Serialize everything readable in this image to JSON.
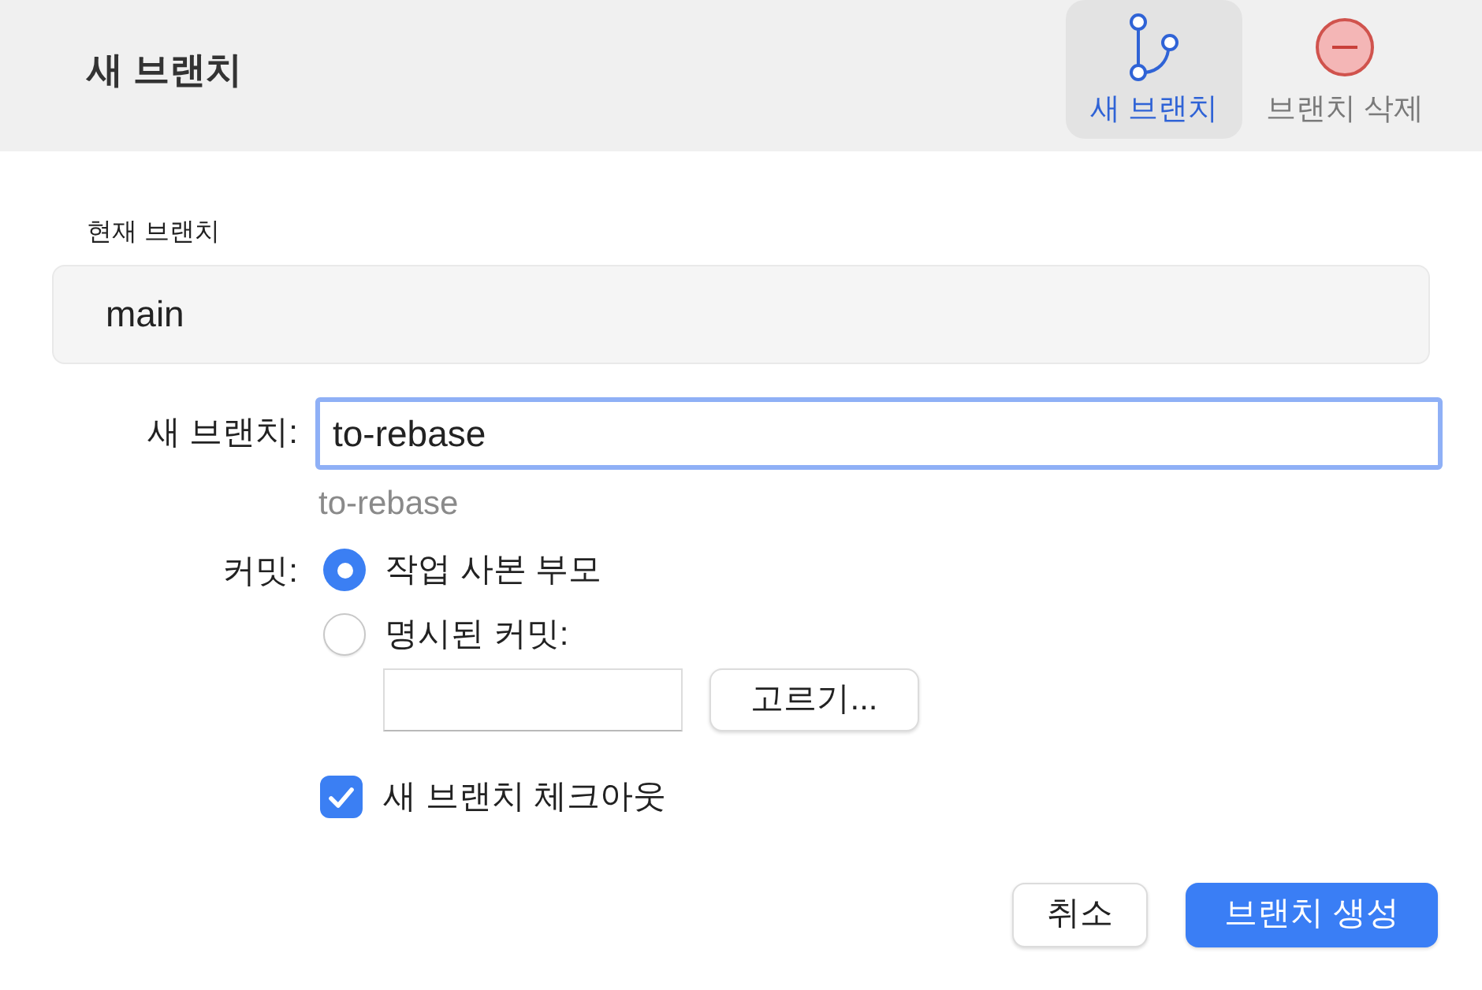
{
  "header": {
    "title": "새 브랜치",
    "toolbar": [
      {
        "label": "새 브랜치",
        "kind": "branch",
        "selected": true
      },
      {
        "label": "브랜치 삭제",
        "kind": "delete",
        "selected": false
      }
    ]
  },
  "current_branch": {
    "label": "현재 브랜치",
    "value": "main"
  },
  "new_branch": {
    "label": "새 브랜치:",
    "value": "to-rebase",
    "focused": true,
    "hint": "to-rebase"
  },
  "commit": {
    "label": "커밋:",
    "options": [
      {
        "label": "작업 사본 부모",
        "selected": true
      },
      {
        "label": "명시된 커밋:",
        "selected": false
      }
    ],
    "choose_button": "고르기..."
  },
  "checkout": {
    "label": "새 브랜치 체크아웃",
    "checked": true
  },
  "buttons": [
    {
      "label": "취소",
      "kind": "secondary"
    },
    {
      "label": "브랜치 생성",
      "kind": "primary"
    }
  ]
}
